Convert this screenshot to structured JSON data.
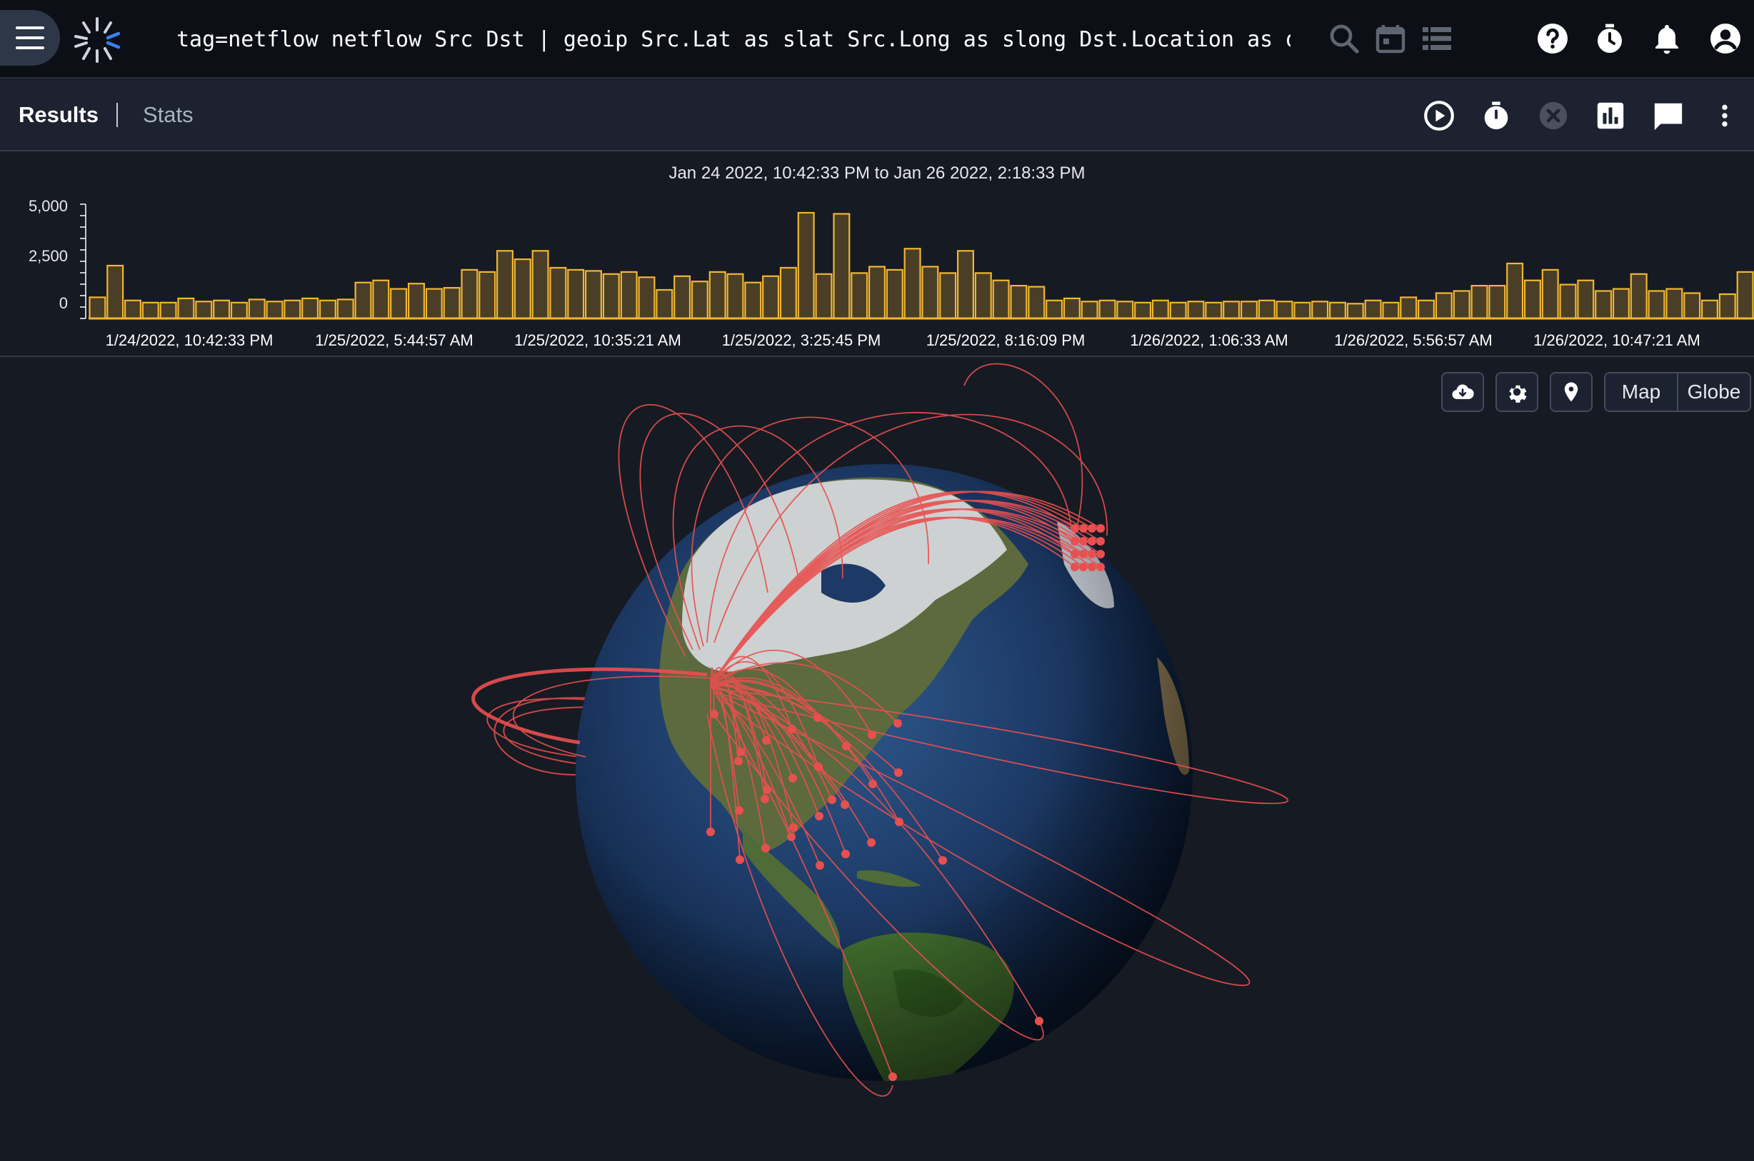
{
  "topbar": {
    "query": "tag=netflow netflow Src Dst | geoip Src.Lat as slat Src.Long as slong Dst.Location as dst |…",
    "icons": [
      "menu-icon",
      "gravwell-logo",
      "search-icon",
      "calendar-icon",
      "list-icon",
      "help-icon",
      "timer-icon",
      "bell-icon",
      "account-icon"
    ]
  },
  "tabs": {
    "results_label": "Results",
    "stats_label": "Stats",
    "toolbar_icons": [
      "play-circle-icon",
      "stopwatch-icon",
      "cancel-icon",
      "chart-icon",
      "comment-icon",
      "more-vert-icon"
    ]
  },
  "histogram": {
    "range_label": "Jan 24 2022, 10:42:33 PM to Jan 26 2022, 2:18:33 PM",
    "y_ticks": [
      "5,000",
      "2,500",
      "0"
    ],
    "x_ticks": [
      "1/24/2022, 10:42:33 PM",
      "1/25/2022, 5:44:57 AM",
      "1/25/2022, 10:35:21 AM",
      "1/25/2022, 3:25:45 PM",
      "1/25/2022, 8:16:09 PM",
      "1/26/2022, 1:06:33 AM",
      "1/26/2022, 5:56:57 AM",
      "1/26/2022, 10:47:21 AM"
    ],
    "bar_color": "#f2b632"
  },
  "chart_data": {
    "type": "bar",
    "title": "Jan 24 2022, 10:42:33 PM to Jan 26 2022, 2:18:33 PM",
    "ylim": [
      0,
      5000
    ],
    "values": [
      1000,
      2500,
      850,
      750,
      750,
      950,
      800,
      850,
      750,
      900,
      800,
      850,
      950,
      850,
      900,
      1700,
      1800,
      1400,
      1650,
      1400,
      1450,
      2300,
      2200,
      3200,
      2800,
      3200,
      2400,
      2300,
      2250,
      2100,
      2200,
      1950,
      1350,
      2000,
      1750,
      2200,
      2100,
      1700,
      2000,
      2400,
      5000,
      2100,
      4950,
      2150,
      2450,
      2300,
      3300,
      2450,
      2150,
      3200,
      2150,
      1800,
      1550,
      1500,
      850,
      950,
      800,
      850,
      800,
      750,
      850,
      750,
      800,
      750,
      800,
      800,
      850,
      800,
      750,
      800,
      750,
      700,
      850,
      750,
      1000,
      850,
      1200,
      1300,
      1550,
      1550,
      2600,
      1800,
      2300,
      1600,
      1800,
      1300,
      1400,
      2100,
      1300,
      1400,
      1200,
      850,
      1150,
      2200
    ]
  },
  "map_controls": {
    "icons": [
      "cloud-download-icon",
      "gear-icon",
      "map-pin-icon"
    ],
    "map_label": "Map",
    "globe_label": "Globe"
  },
  "globe": {
    "arc_color": "#e8504f",
    "ocean_color": "#1f3c68"
  }
}
